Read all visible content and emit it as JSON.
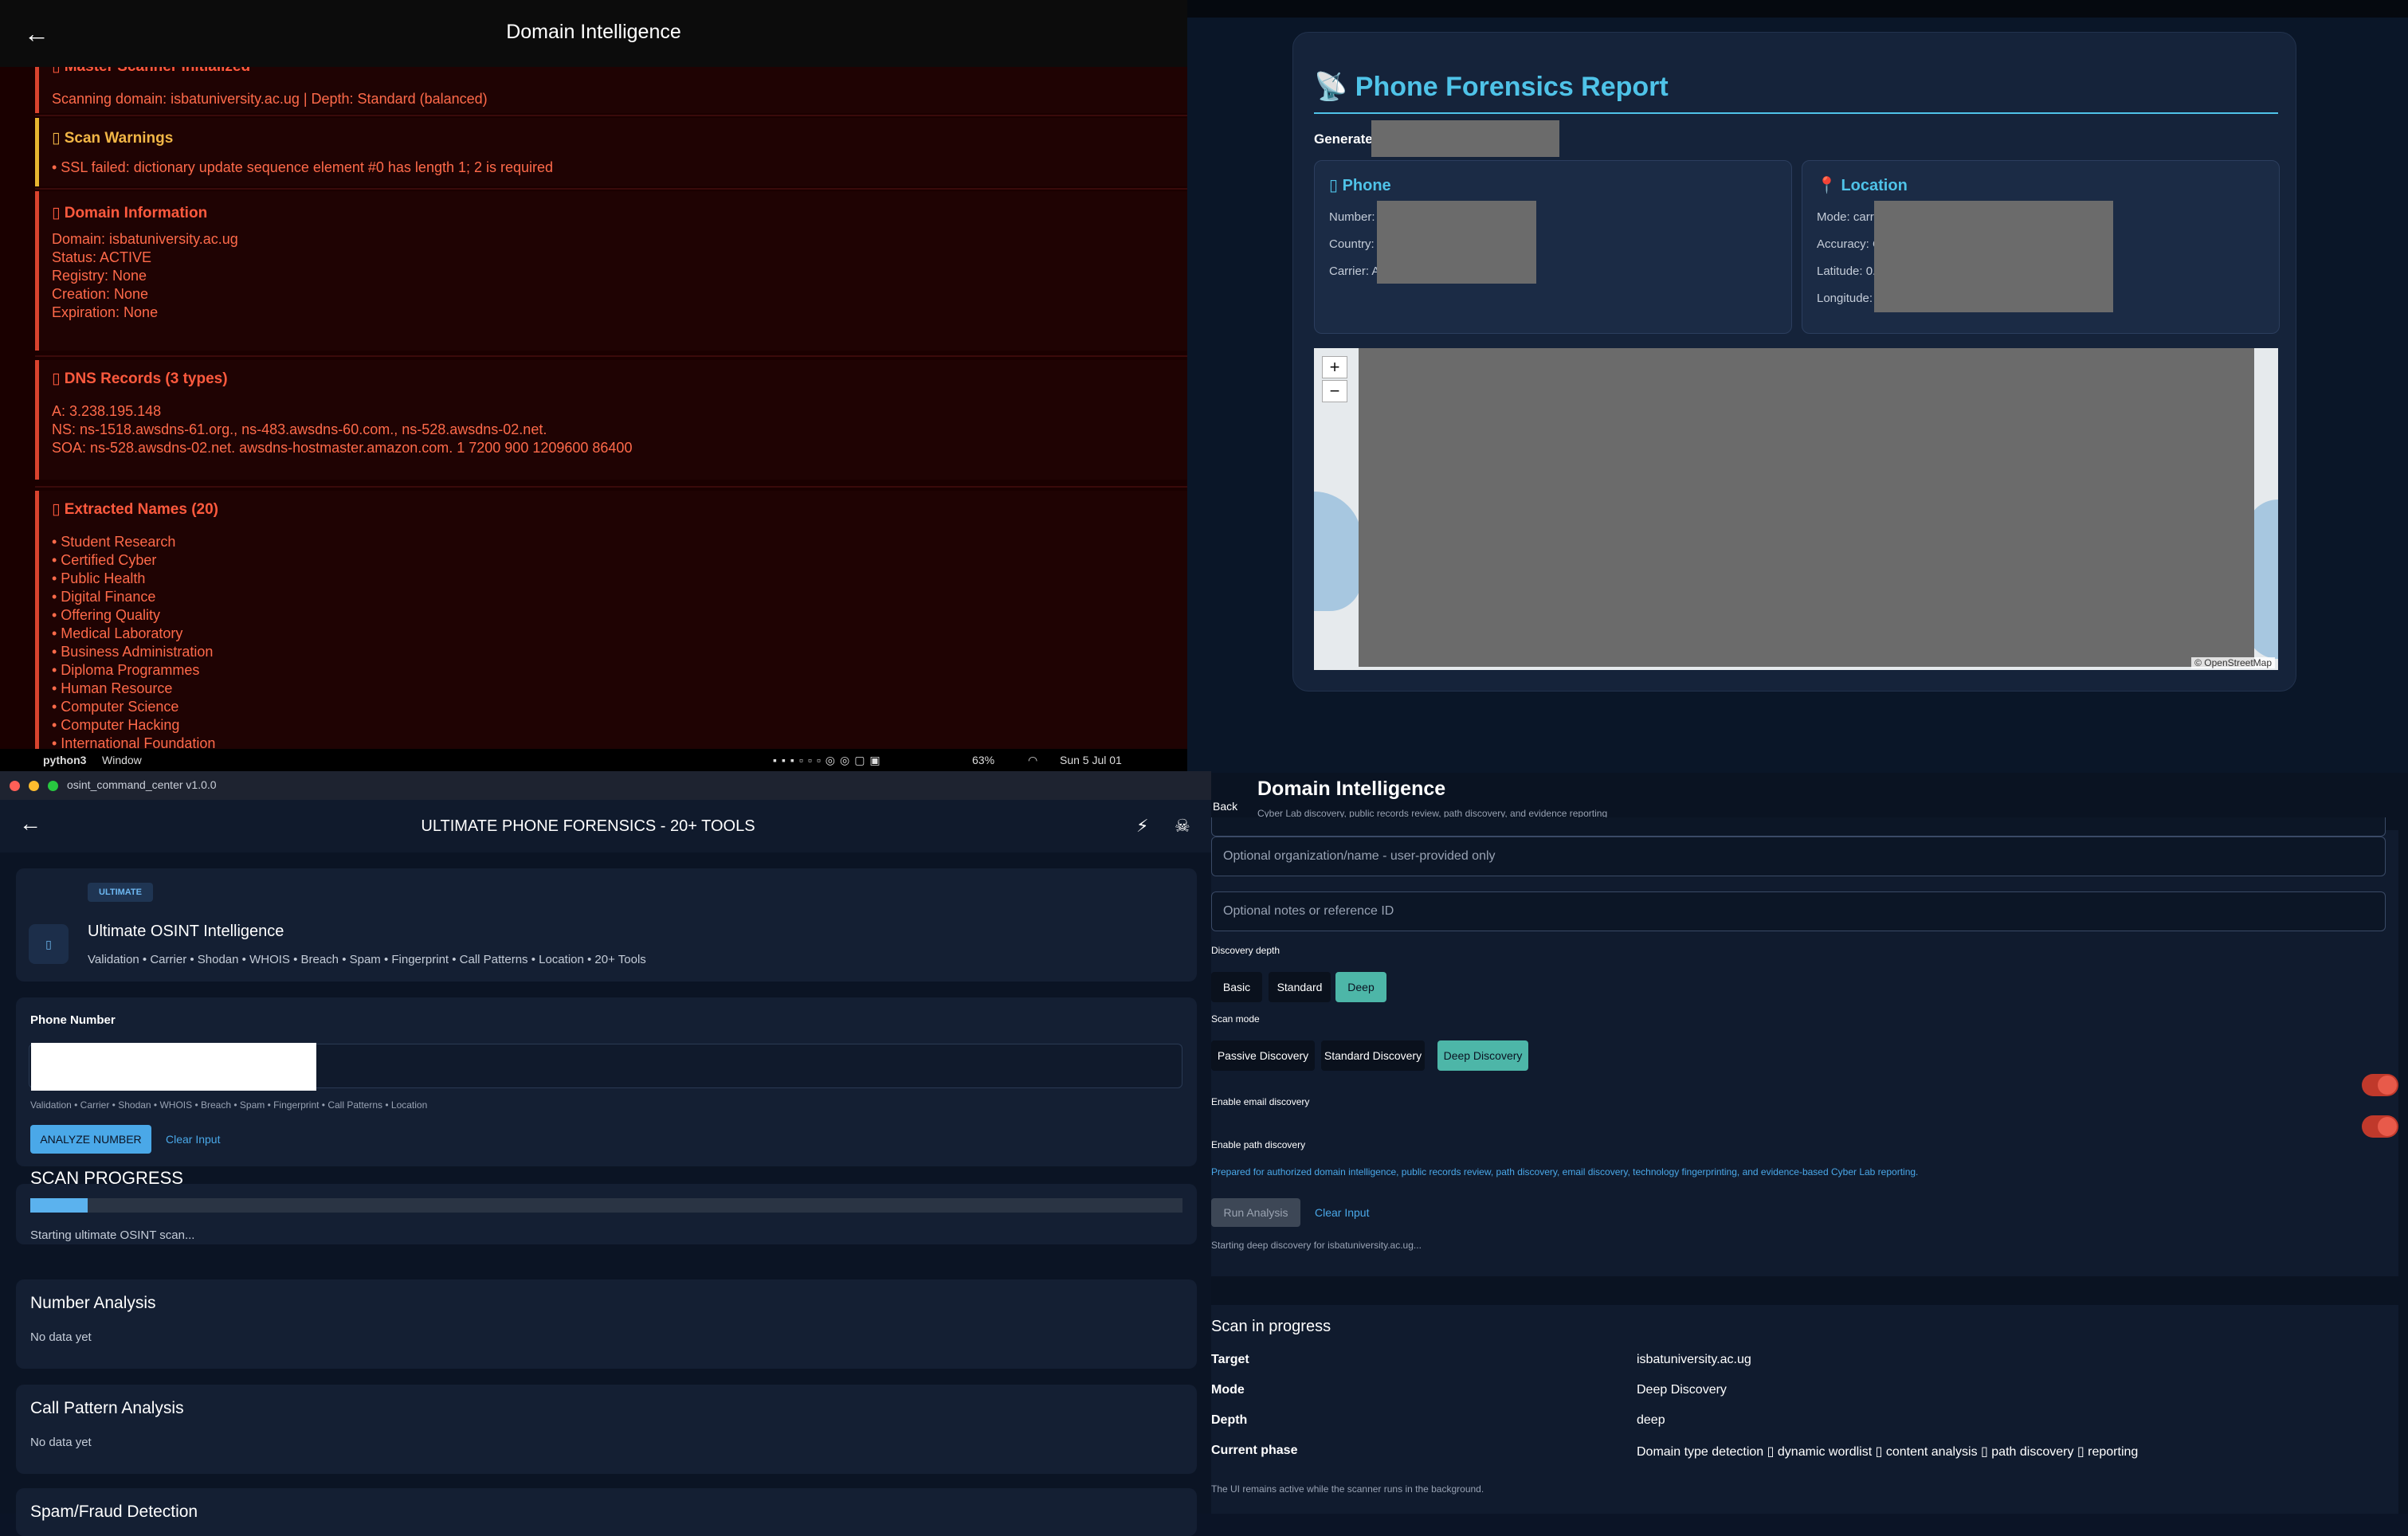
{
  "top_left": {
    "title": "Domain Intelligence",
    "cards": [
      {
        "title": "▯ Master Scanner Initialized",
        "body": "Scanning domain: isbatuniversity.ac.ug | Depth: Standard (balanced)"
      },
      {
        "title": "▯ Scan Warnings",
        "body": "• SSL failed: dictionary update sequence element #0 has length 1; 2 is required"
      },
      {
        "title": "▯ Domain Information",
        "body": "Domain: isbatuniversity.ac.ug\nStatus: ACTIVE\nRegistry: None\nCreation: None\nExpiration: None"
      },
      {
        "title": "▯ DNS Records (3 types)",
        "body": "A: 3.238.195.148\nNS: ns-1518.awsdns-61.org., ns-483.awsdns-60.com., ns-528.awsdns-02.net.\nSOA: ns-528.awsdns-02.net. awsdns-hostmaster.amazon.com. 1 7200 900 1209600 86400"
      },
      {
        "title": "▯ Extracted Names (20)",
        "body": "• Student Research\n• Certified Cyber\n• Public Health\n• Digital Finance\n• Offering Quality\n• Medical Laboratory\n• Business Administration\n• Diploma Programmes\n• Human Resource\n• Computer Science\n• Computer Hacking\n• International Foundation"
      }
    ]
  },
  "menubar": {
    "app": "python3",
    "menu": "Window",
    "battery": "63%",
    "clock": "Sun 5 Jul  01"
  },
  "top_right": {
    "title": "Phone Forensics Report",
    "generated_label": "Generated: 2",
    "phone_box": {
      "title": "Phone",
      "rows": [
        "Number:",
        "Country:",
        "Carrier: A"
      ]
    },
    "location_box": {
      "title": "Location",
      "rows": [
        "Mode: carri",
        "Accuracy: C",
        "Latitude: 0.4",
        "Longitude: 3"
      ]
    },
    "map": {
      "zoom_in": "+",
      "zoom_out": "−",
      "attribution": "© OpenStreetMap"
    }
  },
  "bottom_left": {
    "window_title": "osint_command_center v1.0.0",
    "title": "ULTIMATE PHONE FORENSICS - 20+ TOOLS",
    "badge": "ULTIMATE",
    "heading": "Ultimate OSINT Intelligence",
    "subheading": "Validation • Carrier • Shodan • WHOIS • Breach • Spam • Fingerprint • Call Patterns • Location • 20+ Tools",
    "phone_label": "Phone Number",
    "input_hint": "Validation • Carrier • Shodan • WHOIS • Breach • Spam • Fingerprint • Call Patterns • Location",
    "analyze_button": "ANALYZE NUMBER",
    "clear_link": "Clear Input",
    "progress_title": "SCAN PROGRESS",
    "progress_status": "Starting ultimate OSINT scan...",
    "progress_value": 0.05,
    "sections": [
      {
        "title": "Number Analysis",
        "body": "No data yet"
      },
      {
        "title": "Call Pattern Analysis",
        "body": "No data yet"
      },
      {
        "title": "Spam/Fraud Detection",
        "body": ""
      }
    ]
  },
  "bottom_right": {
    "back": "Back",
    "title": "Domain Intelligence",
    "subtitle": "Cyber Lab discovery, public records review, path discovery, and evidence reporting",
    "org_placeholder": "Optional organization/name - user-provided only",
    "notes_placeholder": "Optional notes or reference ID",
    "depth_label": "Discovery depth",
    "depth_options": [
      "Basic",
      "Standard",
      "Deep"
    ],
    "mode_label": "Scan mode",
    "mode_options": [
      "Passive Discovery",
      "Standard Discovery",
      "Deep Discovery"
    ],
    "email_toggle": "Enable email discovery",
    "path_toggle": "Enable path discovery",
    "note": "Prepared for authorized domain intelligence, public records review, path discovery, email discovery, technology fingerprinting, and evidence-based Cyber Lab reporting.",
    "run_button": "Run Analysis",
    "clear_link": "Clear Input",
    "starting": "Starting deep discovery for isbatuniversity.ac.ug...",
    "scan": {
      "title": "Scan in progress",
      "rows": [
        {
          "key": "Target",
          "value": "isbatuniversity.ac.ug"
        },
        {
          "key": "Mode",
          "value": "Deep Discovery"
        },
        {
          "key": "Depth",
          "value": "deep"
        },
        {
          "key": "Current phase",
          "value": "Domain type detection ▯ dynamic wordlist ▯ content analysis ▯ path discovery ▯ reporting"
        }
      ],
      "footer": "The UI remains active while the scanner runs in the background."
    }
  },
  "colors": {
    "red_accent": "#d9432e",
    "warn_accent": "#e7b530",
    "cyan": "#4fc3e8",
    "teal": "#4db6a8",
    "blue": "#4aa8e8"
  }
}
